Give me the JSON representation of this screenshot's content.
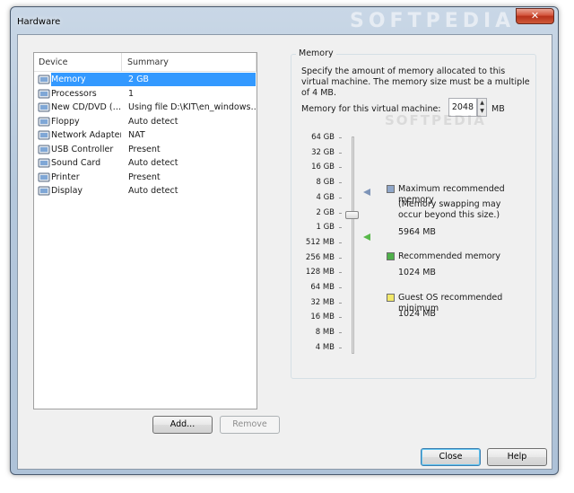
{
  "window": {
    "title": "Hardware",
    "watermark": "SOFTPEDIA",
    "close_glyph": "✕"
  },
  "device_list": {
    "columns": {
      "device": "Device",
      "summary": "Summary"
    },
    "rows": [
      {
        "icon": "memory-icon",
        "name": "Memory",
        "summary": "2 GB",
        "selected": true
      },
      {
        "icon": "processor-icon",
        "name": "Processors",
        "summary": "1"
      },
      {
        "icon": "cd-dvd-icon",
        "name": "New CD/DVD (…",
        "summary": "Using file D:\\KIT\\en_windows…"
      },
      {
        "icon": "floppy-icon",
        "name": "Floppy",
        "summary": "Auto detect"
      },
      {
        "icon": "network-adapter-icon",
        "name": "Network Adapter",
        "summary": "NAT"
      },
      {
        "icon": "usb-icon",
        "name": "USB Controller",
        "summary": "Present"
      },
      {
        "icon": "sound-card-icon",
        "name": "Sound Card",
        "summary": "Auto detect"
      },
      {
        "icon": "printer-icon",
        "name": "Printer",
        "summary": "Present"
      },
      {
        "icon": "display-icon",
        "name": "Display",
        "summary": "Auto detect"
      }
    ]
  },
  "buttons": {
    "add": "Add...",
    "remove": "Remove",
    "close": "Close",
    "help": "Help"
  },
  "memory": {
    "group_title": "Memory",
    "description": "Specify the amount of memory allocated to this virtual machine. The memory size must be a multiple of 4 MB.",
    "field_label": "Memory for this virtual machine:",
    "value": "2048",
    "unit": "MB",
    "scale": [
      "64 GB",
      "32 GB",
      "16 GB",
      "8 GB",
      "4 GB",
      "2 GB",
      "1 GB",
      "512 MB",
      "256 MB",
      "128 MB",
      "64 MB",
      "32 MB",
      "16 MB",
      "8 MB",
      "4 MB"
    ],
    "legend": {
      "max": {
        "title": "Maximum recommended memory",
        "note": "(Memory swapping may occur beyond this size.)",
        "value": "5964 MB",
        "color": "#8fa6c8"
      },
      "recommended": {
        "title": "Recommended memory",
        "value": "1024 MB",
        "color": "#4fb04a"
      },
      "guest_min": {
        "title": "Guest OS recommended minimum",
        "value": "1024 MB",
        "color": "#f2e86a"
      }
    }
  },
  "colors": {
    "selection": "#3399ff",
    "max_marker": "#7d94b8",
    "rec_marker": "#58b94a"
  }
}
